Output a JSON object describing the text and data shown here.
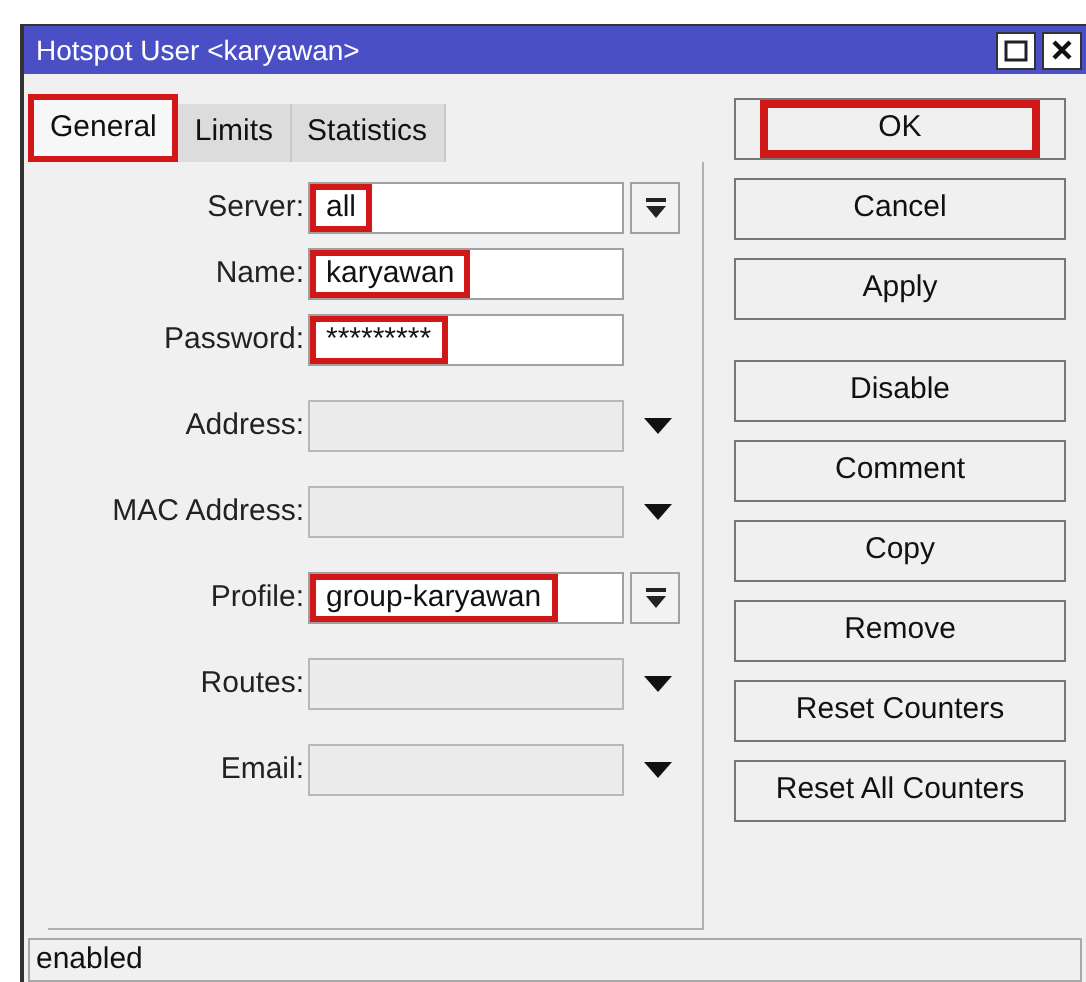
{
  "window": {
    "title": "Hotspot User <karyawan>"
  },
  "tabs": [
    {
      "label": "General",
      "selected": true,
      "highlighted": true
    },
    {
      "label": "Limits",
      "selected": false,
      "highlighted": false
    },
    {
      "label": "Statistics",
      "selected": false,
      "highlighted": false
    }
  ],
  "fields": [
    {
      "label": "Server:",
      "kind": "combo",
      "value": "all",
      "highlighted": true
    },
    {
      "label": "Name:",
      "kind": "text",
      "value": "karyawan",
      "highlighted": true
    },
    {
      "label": "Password:",
      "kind": "text",
      "value": "*********",
      "highlighted": true
    },
    {
      "label": "Address:",
      "kind": "dropdown",
      "disabled": true,
      "highlighted": false
    },
    {
      "label": "MAC Address:",
      "kind": "dropdown",
      "disabled": true,
      "highlighted": false
    },
    {
      "label": "Profile:",
      "kind": "combo",
      "value": "group-karyawan",
      "highlighted": true
    },
    {
      "label": "Routes:",
      "kind": "dropdown",
      "disabled": true,
      "highlighted": false
    },
    {
      "label": "Email:",
      "kind": "dropdown",
      "disabled": true,
      "highlighted": false
    }
  ],
  "buttons": [
    {
      "label": "OK",
      "highlighted": true
    },
    {
      "label": "Cancel",
      "highlighted": false
    },
    {
      "label": "Apply",
      "highlighted": false
    },
    {
      "label": "Disable",
      "highlighted": false
    },
    {
      "label": "Comment",
      "highlighted": false
    },
    {
      "label": "Copy",
      "highlighted": false
    },
    {
      "label": "Remove",
      "highlighted": false
    },
    {
      "label": "Reset Counters",
      "highlighted": false
    },
    {
      "label": "Reset All Counters",
      "highlighted": false
    }
  ],
  "status_bar": {
    "text": "enabled"
  }
}
